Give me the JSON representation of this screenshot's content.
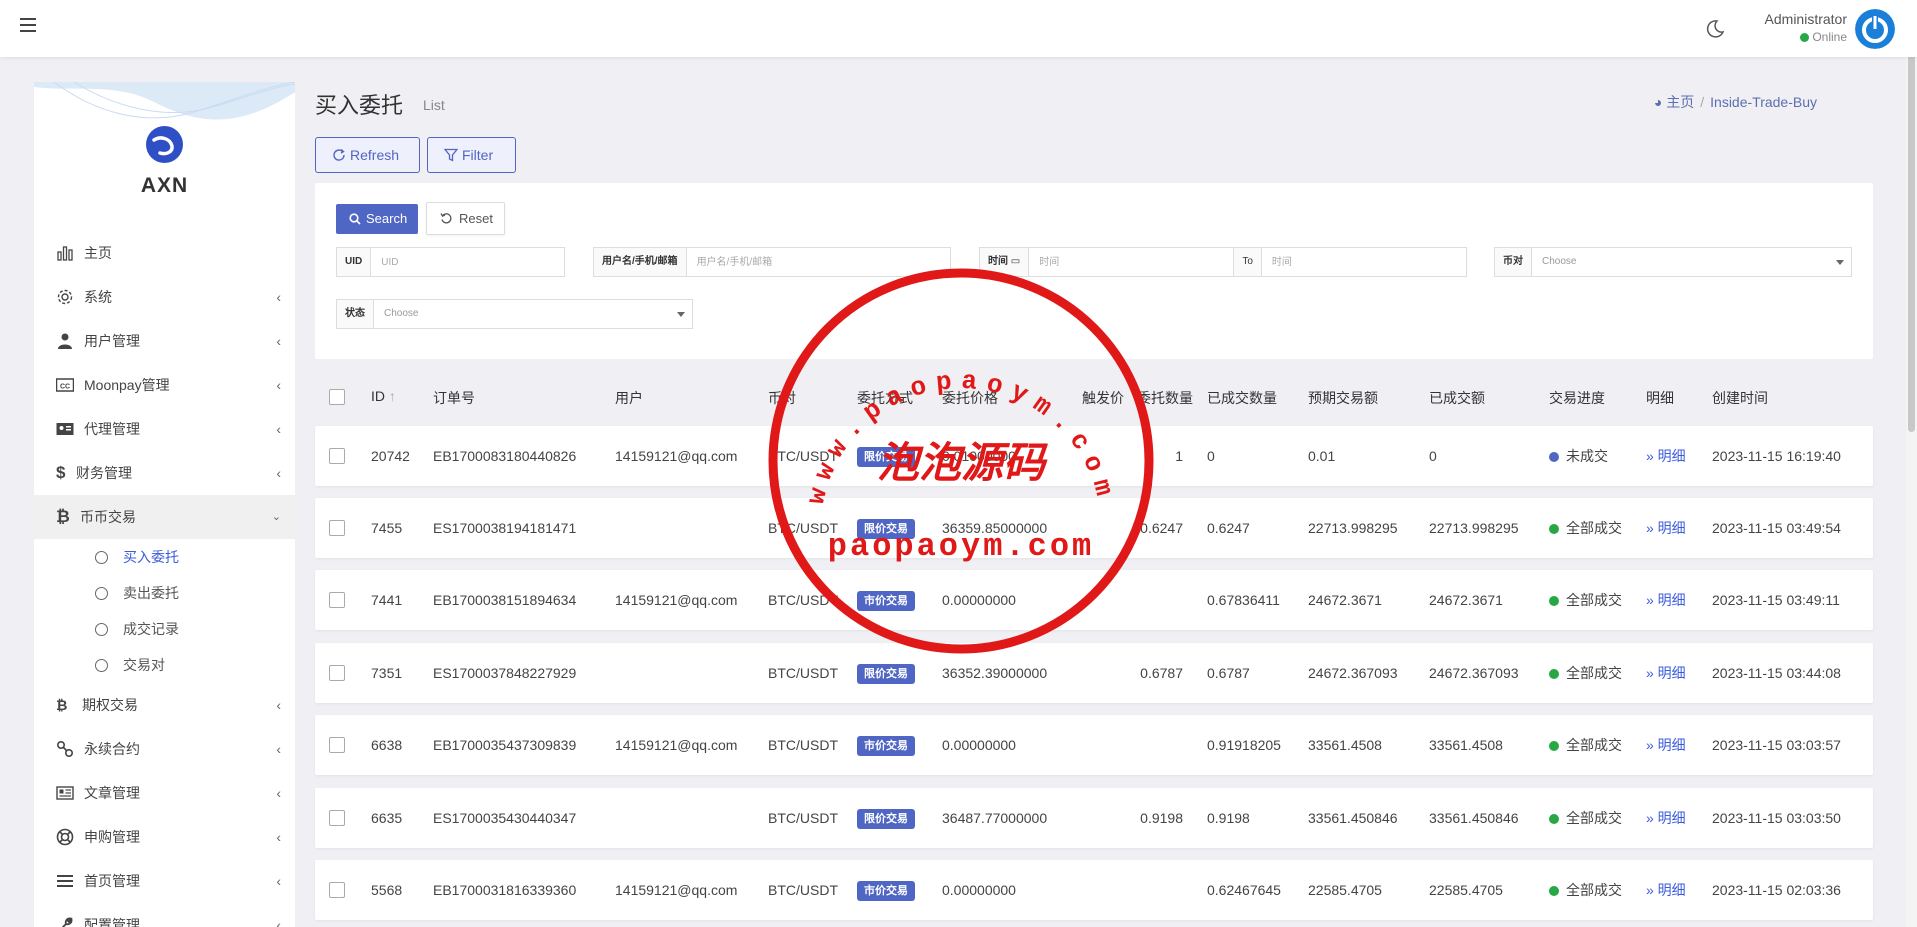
{
  "header": {
    "user_name": "Administrator",
    "user_status": "Online"
  },
  "sidebar": {
    "logo_text": "AXN",
    "items": [
      {
        "label": "主页",
        "icon": "bar-chart-icon",
        "has_children": false
      },
      {
        "label": "系统",
        "icon": "gear-icon",
        "has_children": true
      },
      {
        "label": "用户管理",
        "icon": "user-tie-icon",
        "has_children": true
      },
      {
        "label": "Moonpay管理",
        "icon": "cc-icon",
        "has_children": true
      },
      {
        "label": "代理管理",
        "icon": "id-card-icon",
        "has_children": true
      },
      {
        "label": "财务管理",
        "icon": "dollar-icon",
        "has_children": true
      },
      {
        "label": "币币交易",
        "icon": "bitcoin-icon",
        "has_children": true,
        "expanded": true
      }
    ],
    "subitems": [
      {
        "label": "买入委托",
        "current": true
      },
      {
        "label": "卖出委托",
        "current": false
      },
      {
        "label": "成交记录",
        "current": false
      },
      {
        "label": "交易对",
        "current": false
      }
    ],
    "items_after": [
      {
        "label": "期权交易",
        "icon": "bitcoin-icon",
        "has_children": true
      },
      {
        "label": "永续合约",
        "icon": "link-icon",
        "has_children": true
      },
      {
        "label": "文章管理",
        "icon": "newspaper-icon",
        "has_children": true
      },
      {
        "label": "申购管理",
        "icon": "lifebuoy-icon",
        "has_children": true
      },
      {
        "label": "首页管理",
        "icon": "list-icon",
        "has_children": true
      },
      {
        "label": "配置管理",
        "icon": "wrench-icon",
        "has_children": true
      }
    ]
  },
  "page": {
    "title": "买入委托",
    "subtitle": "List",
    "breadcrumb": [
      "主页",
      "Inside-Trade-Buy"
    ],
    "refresh_label": "Refresh",
    "filter_label": "Filter"
  },
  "filters": {
    "search_label": "Search",
    "reset_label": "Reset",
    "uid_label": "UID",
    "uid_placeholder": "UID",
    "user_label": "用户名/手机/邮箱",
    "user_placeholder": "用户名/手机/邮箱",
    "time_label": "时间",
    "time_placeholder": "时间",
    "to_label": "To",
    "to_placeholder": "时间",
    "pair_label": "币对",
    "pair_value": "Choose",
    "status_label": "状态",
    "status_value": "Choose"
  },
  "table": {
    "columns": [
      "ID",
      "订单号",
      "用户",
      "币对",
      "委托方式",
      "委托价格",
      "触发价",
      "委托数量",
      "已成交数量",
      "预期交易额",
      "已成交额",
      "交易进度",
      "明细",
      "创建时间"
    ],
    "detail_label": "» 明细",
    "rows": [
      {
        "id": "20742",
        "order_no": "EB1700083180440826",
        "user": "14159121@qq.com",
        "pair": "BTC/USDT",
        "method": "限价交易",
        "price": "0.01000000",
        "trigger": "",
        "qty": "1",
        "filled_qty": "0",
        "expected": "0.01",
        "filled_amt": "0",
        "progress": "未成交",
        "progress_color": "#5066c4",
        "created": "2023-11-15 16:19:40"
      },
      {
        "id": "7455",
        "order_no": "ES1700038194181471",
        "user": "",
        "pair": "BTC/USDT",
        "method": "限价交易",
        "price": "36359.85000000",
        "trigger": "",
        "qty": "0.6247",
        "filled_qty": "0.6247",
        "expected": "22713.998295",
        "filled_amt": "22713.998295",
        "progress": "全部成交",
        "progress_color": "#28a745",
        "created": "2023-11-15 03:49:54"
      },
      {
        "id": "7441",
        "order_no": "EB1700038151894634",
        "user": "14159121@qq.com",
        "pair": "BTC/USDT",
        "method": "市价交易",
        "price": "0.00000000",
        "trigger": "",
        "qty": "",
        "filled_qty": "0.67836411",
        "expected": "24672.3671",
        "filled_amt": "24672.3671",
        "progress": "全部成交",
        "progress_color": "#28a745",
        "created": "2023-11-15 03:49:11"
      },
      {
        "id": "7351",
        "order_no": "ES1700037848227929",
        "user": "",
        "pair": "BTC/USDT",
        "method": "限价交易",
        "price": "36352.39000000",
        "trigger": "",
        "qty": "0.6787",
        "filled_qty": "0.6787",
        "expected": "24672.367093",
        "filled_amt": "24672.367093",
        "progress": "全部成交",
        "progress_color": "#28a745",
        "created": "2023-11-15 03:44:08"
      },
      {
        "id": "6638",
        "order_no": "EB1700035437309839",
        "user": "14159121@qq.com",
        "pair": "BTC/USDT",
        "method": "市价交易",
        "price": "0.00000000",
        "trigger": "",
        "qty": "",
        "filled_qty": "0.91918205",
        "expected": "33561.4508",
        "filled_amt": "33561.4508",
        "progress": "全部成交",
        "progress_color": "#28a745",
        "created": "2023-11-15 03:03:57"
      },
      {
        "id": "6635",
        "order_no": "ES1700035430440347",
        "user": "",
        "pair": "BTC/USDT",
        "method": "限价交易",
        "price": "36487.77000000",
        "trigger": "",
        "qty": "0.9198",
        "filled_qty": "0.9198",
        "expected": "33561.450846",
        "filled_amt": "33561.450846",
        "progress": "全部成交",
        "progress_color": "#28a745",
        "created": "2023-11-15 03:03:50"
      },
      {
        "id": "5568",
        "order_no": "EB1700031816339360",
        "user": "14159121@qq.com",
        "pair": "BTC/USDT",
        "method": "市价交易",
        "price": "0.00000000",
        "trigger": "",
        "qty": "",
        "filled_qty": "0.62467645",
        "expected": "22585.4705",
        "filled_amt": "22585.4705",
        "progress": "全部成交",
        "progress_color": "#28a745",
        "created": "2023-11-15 02:03:36"
      }
    ]
  },
  "watermark": {
    "arc_text": "www.paopaoym.com",
    "center_text": "泡泡源码",
    "bottom_text": "paopaoym.com",
    "color": "#e01818"
  }
}
